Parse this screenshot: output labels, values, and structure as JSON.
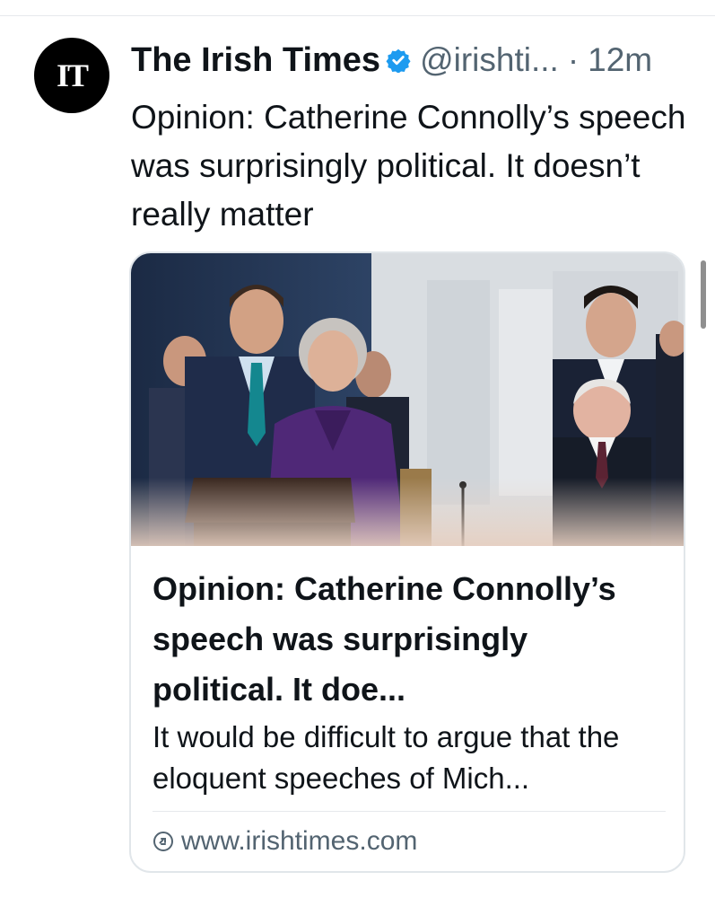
{
  "tweet": {
    "author": {
      "avatar_text": "IT",
      "name": "The Irish Times",
      "handle": "@irishti...",
      "verified_icon": "verified-badge-icon",
      "verified_color": "#1d9bf0"
    },
    "separator": "·",
    "time": "12m",
    "text": "Opinion: Catherine Connolly’s speech was surprisingly political. It doesn’t really matter"
  },
  "card": {
    "image_icon": "article-photo",
    "title": "Opinion: Catherine Connolly’s speech was surprisingly political. It doe...",
    "description": "It would be difficult to argue that the eloquent speeches of Mich...",
    "url_icon": "link-icon",
    "url": "www.irishtimes.com"
  },
  "colors": {
    "text_primary": "#0f1419",
    "text_secondary": "#536471",
    "border": "#e1e6ea"
  }
}
